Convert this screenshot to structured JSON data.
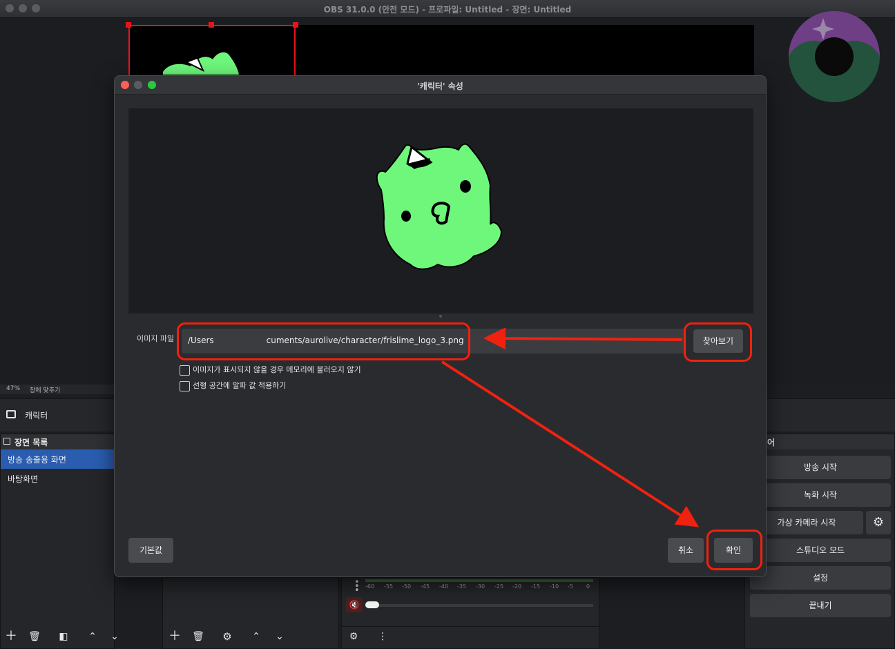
{
  "window": {
    "title": "OBS 31.0.0 (안전 모드) - 프로파일: Untitled - 장면: Untitled"
  },
  "preview_status": {
    "zoom": "47%",
    "fit_label": "창에 맞추기"
  },
  "sources": {
    "item_label": "캐릭터"
  },
  "scenes": {
    "header": "장면 목록",
    "items": [
      {
        "label": "방송 송출용 화면",
        "active": true
      },
      {
        "label": "바탕화면",
        "active": false
      }
    ]
  },
  "controls": {
    "header_fragment": "어",
    "start_streaming": "방송 시작",
    "start_recording": "녹화 시작",
    "start_virtual_camera": "가상 카메라 시작",
    "studio_mode": "스튜디오 모드",
    "settings": "설정",
    "exit": "끝내기"
  },
  "audio_meter": {
    "ticks": [
      "-60",
      "-55",
      "-50",
      "-45",
      "-40",
      "-35",
      "-30",
      "-25",
      "-20",
      "-15",
      "-10",
      "-5",
      "0"
    ]
  },
  "dialog": {
    "title": "'캐릭터' 속성",
    "image_file_label": "이미지 파일",
    "path_prefix": "/Users",
    "path_suffix": "cuments/aurolive/character/frislime_logo_3.png",
    "browse_button": "찾아보기",
    "checkbox_unload": "이미지가 표시되지 않을 경우 메모리에 불러오지 않기",
    "checkbox_linear_alpha": "선형 공간에 알파 값 적용하기",
    "defaults_button": "기본값",
    "cancel_button": "취소",
    "ok_button": "확인"
  },
  "colors": {
    "annotation_red": "#f0220f",
    "selection_red": "#e8141b",
    "slime_green": "#6ff77c",
    "active_scene_blue": "#2a5db0"
  }
}
